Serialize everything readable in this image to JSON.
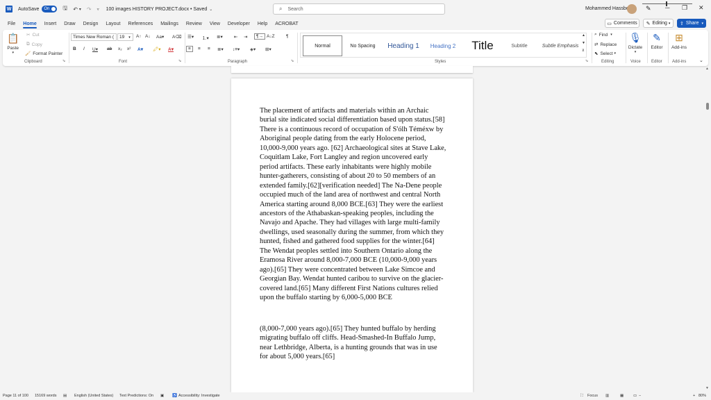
{
  "titlebar": {
    "app_icon": "W",
    "autosave_label": "AutoSave",
    "autosave_state": "On",
    "doc_title": "100 images HISTORY PROJECT.docx • Saved",
    "search_placeholder": "Search",
    "user_name": "Mohammed Hassbo"
  },
  "tabs": [
    "File",
    "Home",
    "Insert",
    "Draw",
    "Design",
    "Layout",
    "References",
    "Mailings",
    "Review",
    "View",
    "Developer",
    "Help",
    "ACROBAT"
  ],
  "active_tab": "Home",
  "actions": {
    "comments": "Comments",
    "editing": "Editing",
    "share": "Share"
  },
  "ribbon": {
    "clipboard": {
      "label": "Clipboard",
      "paste": "Paste",
      "cut": "Cut",
      "copy": "Copy",
      "format_painter": "Format Painter"
    },
    "font": {
      "label": "Font",
      "font_name": "Times New Roman (",
      "font_size": "19"
    },
    "paragraph": {
      "label": "Paragraph"
    },
    "styles": {
      "label": "Styles",
      "items": [
        "Normal",
        "No Spacing",
        "Heading 1",
        "Heading 2",
        "Title",
        "Subtitle",
        "Subtle Emphasis"
      ]
    },
    "editing": {
      "label": "Editing",
      "find": "Find",
      "replace": "Replace",
      "select": "Select"
    },
    "voice": {
      "label": "Voice",
      "dictate": "Dictate"
    },
    "editor": {
      "label": "Editor",
      "editor": "Editor"
    },
    "addins": {
      "label": "Add-ins",
      "addins": "Add-ins"
    }
  },
  "document": {
    "paragraph_1": "The placement of artifacts and materials within an Archaic burial site indicated social differentiation based upon status.[58] There is a continuous record of occupation of S'ólh Téméxw by Aboriginal people dating from the early Holocene period, 10,000-9,000 years ago. [62] Archaeological sites at Stave Lake, Coquitlam Lake, Fort Langley and region uncovered early period artifacts. These early inhabitants were highly mobile hunter-gatherers, consisting of about 20 to 50 members of an extended family.[62][verification needed] The Na-Dene people occupied much of the land area of northwest and central North America starting around 8,000 BCE.[63] They were the earliest ancestors of the Athabaskan-speaking peoples, including the Navajo and Apache. They had villages with large multi-family dwellings, used seasonally during the summer, from which they hunted, fished and gathered food supplies for the winter.[64] The Wendat peoples settled into Southern Ontario along the Eramosa River around 8,000-7,000 BCE (10,000-9,000 years ago).[65] They were concentrated between Lake Simcoe and Georgian Bay. Wendat hunted caribou to survive on the glacier-covered land.[65] Many different First Nations cultures relied upon the buffalo starting by 6,000-5,000 BCE",
    "paragraph_2": "(8,000-7,000 years ago).[65] They hunted buffalo by herding migrating buffalo off cliffs. Head-Smashed-In Buffalo Jump, near Lethbridge, Alberta, is a hunting grounds that was in use for about 5,000 years.[65]"
  },
  "statusbar": {
    "page": "Page 11 of 100",
    "words": "15169 words",
    "language": "English (United States)",
    "predictions": "Text Predictions: On",
    "accessibility": "Accessibility: Investigate",
    "focus": "Focus",
    "zoom": "80%"
  },
  "colors": {
    "accent": "#185abd",
    "background": "#f3f3f3",
    "page": "#ffffff"
  }
}
